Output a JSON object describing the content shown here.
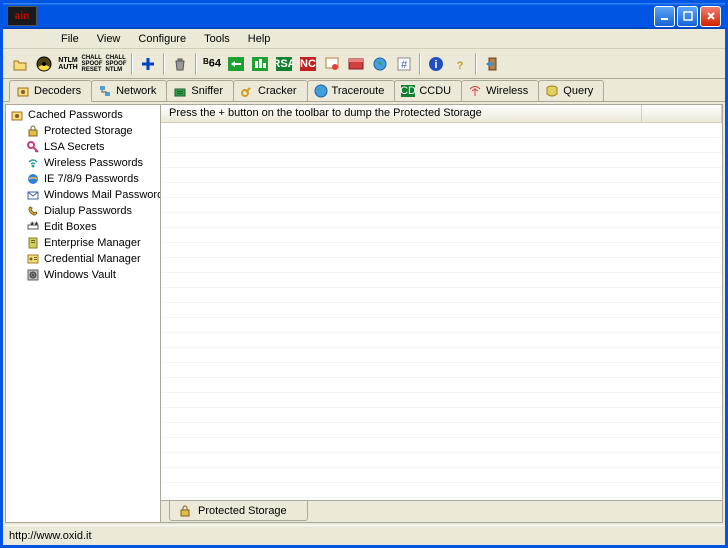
{
  "app_logo_text": "ain",
  "menu": {
    "file": "File",
    "view": "View",
    "configure": "Configure",
    "tools": "Tools",
    "help": "Help"
  },
  "tabs": {
    "decoders": "Decoders",
    "network": "Network",
    "sniffer": "Sniffer",
    "cracker": "Cracker",
    "traceroute": "Traceroute",
    "ccdu": "CCDU",
    "wireless": "Wireless",
    "query": "Query"
  },
  "tree": {
    "root": "Cached Passwords",
    "items": [
      "Protected Storage",
      "LSA Secrets",
      "Wireless Passwords",
      "IE 7/8/9 Passwords",
      "Windows Mail Passwords",
      "Dialup Passwords",
      "Edit Boxes",
      "Enterprise Manager",
      "Credential Manager",
      "Windows Vault"
    ]
  },
  "list_message": "Press the + button on the toolbar to dump the Protected Storage",
  "bottom_tab": "Protected Storage",
  "status": "http://www.oxid.it"
}
